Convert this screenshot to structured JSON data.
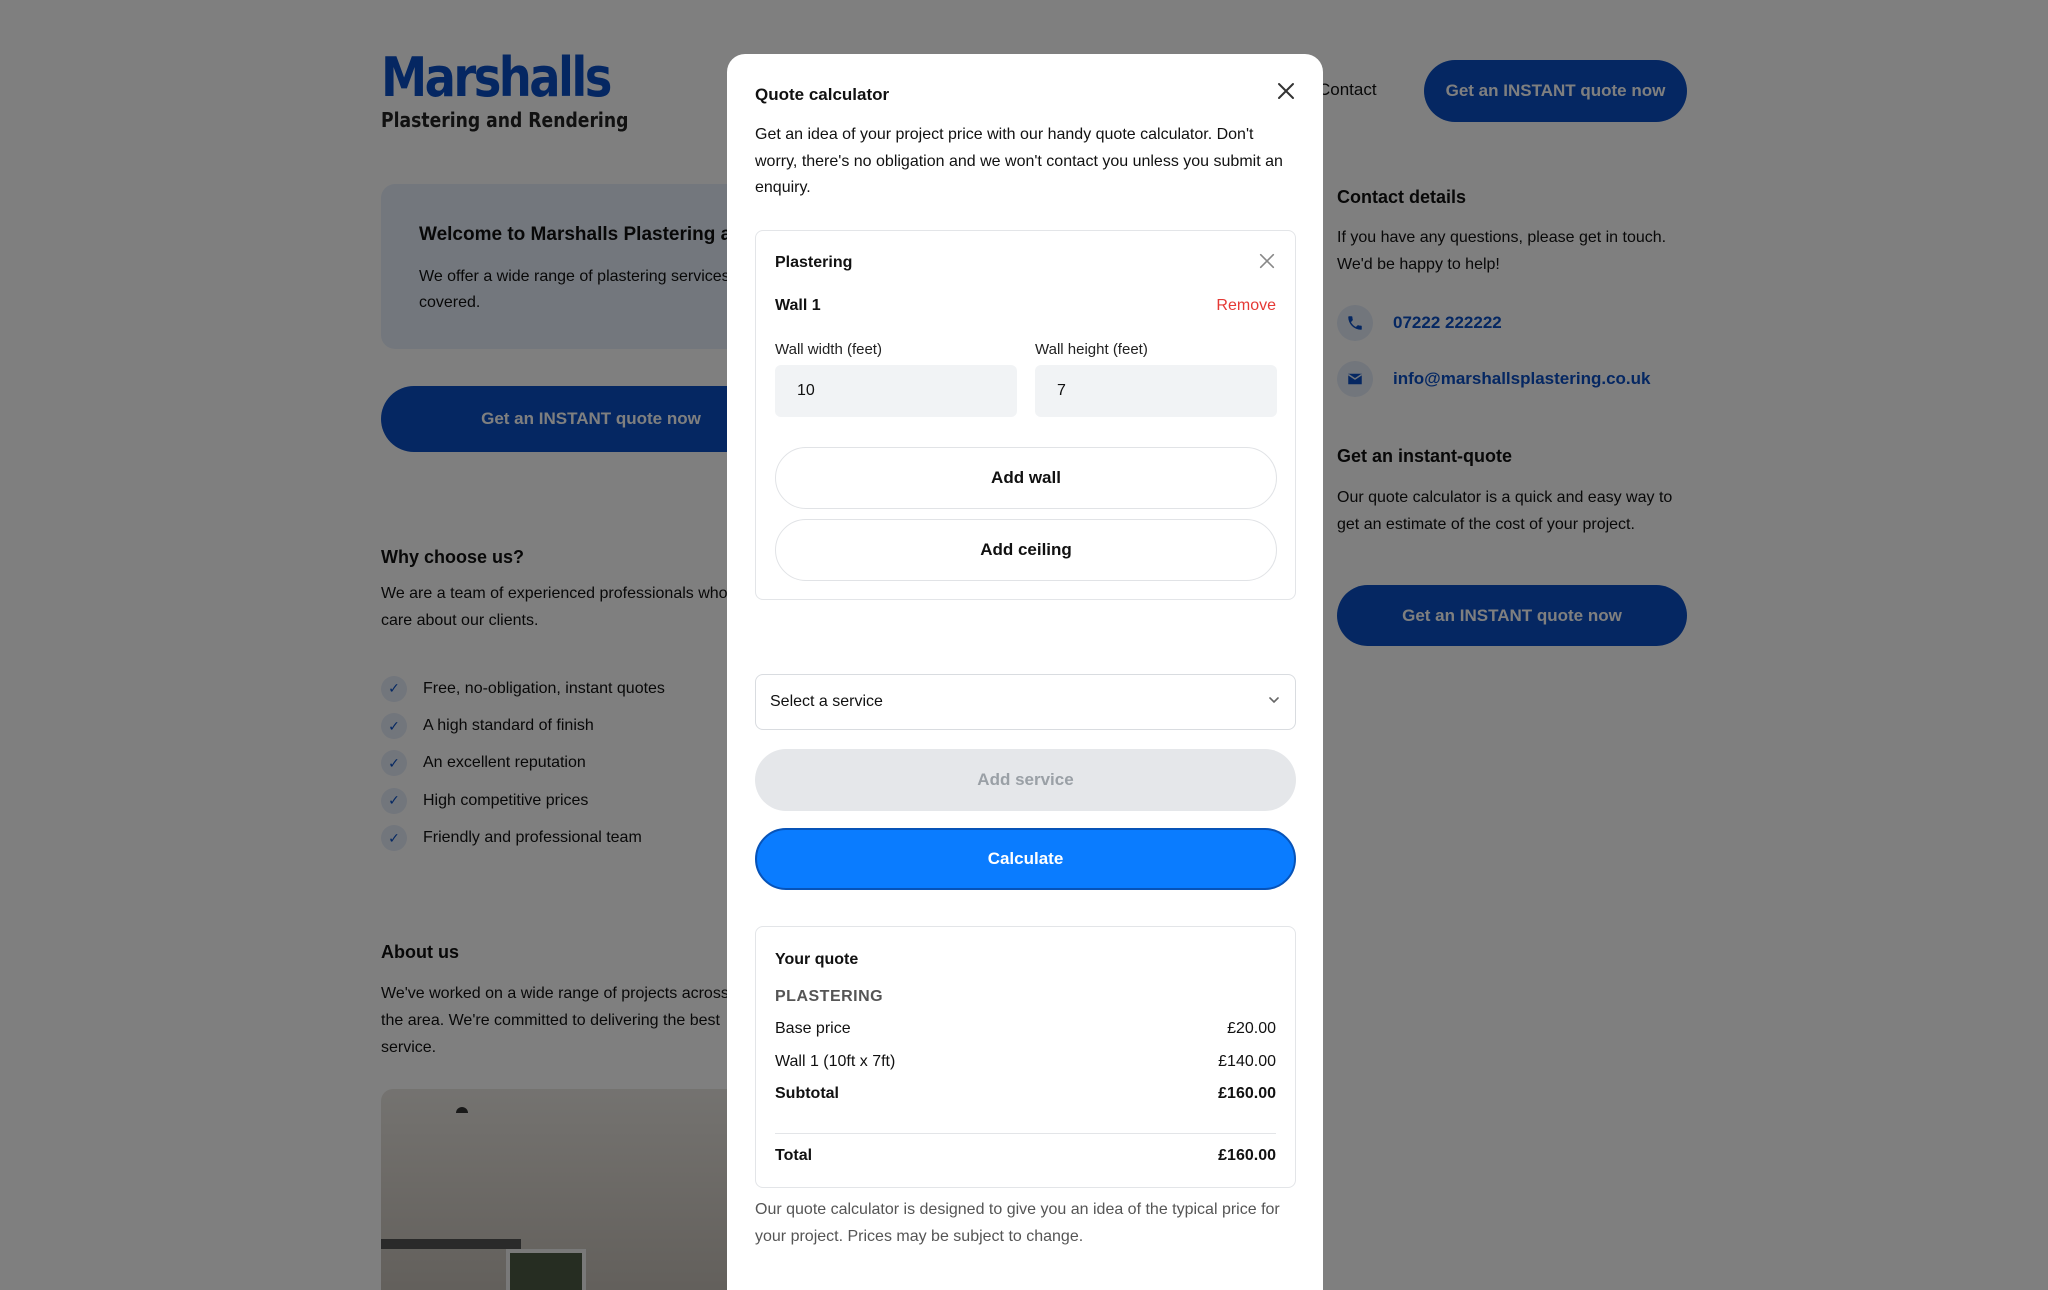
{
  "brand": {
    "name": "Marshalls",
    "tagline": "Plastering and Rendering",
    "accent": "#0a4fc4"
  },
  "header": {
    "nav_contact": "Contact",
    "cta": "Get an INSTANT quote now"
  },
  "hero": {
    "title": "Welcome to Marshalls Plastering and Rendering",
    "text": "We offer a wide range of plastering services to get you covered.",
    "cta": "Get an INSTANT quote now"
  },
  "why": {
    "title": "Why choose us?",
    "text": "We are a team of experienced professionals who care about our clients.",
    "items": [
      "Free, no-obligation, instant quotes",
      "A high standard of finish",
      "An excellent reputation",
      "High competitive prices",
      "Friendly and professional team"
    ]
  },
  "about": {
    "title": "About us",
    "text": "We've worked on a wide range of projects across the area. We're committed to delivering the best service."
  },
  "sidebar": {
    "contact_title": "Contact details",
    "contact_text": "If you have any questions, please get in touch. We'd be happy to help!",
    "phone": "07222 222222",
    "email": "info@marshallsplastering.co.uk",
    "quote_title": "Get an instant-quote",
    "quote_text": "Our quote calculator is a quick and easy way to get an estimate of the cost of your project.",
    "cta": "Get an INSTANT quote now"
  },
  "modal": {
    "title": "Quote calculator",
    "intro": "Get an idea of your project price with our handy quote calculator. Don't worry, there's no obligation and we won't contact you unless you submit an enquiry.",
    "service": {
      "title": "Plastering",
      "wall_name": "Wall 1",
      "remove": "Remove",
      "width_label": "Wall width (feet)",
      "width_value": "10",
      "height_label": "Wall height (feet)",
      "height_value": "7",
      "add_wall": "Add wall",
      "add_ceiling": "Add ceiling"
    },
    "select_placeholder": "Select a service",
    "add_service": "Add service",
    "calculate": "Calculate",
    "quote": {
      "title": "Your quote",
      "section": "PLASTERING",
      "rows": [
        {
          "label": "Base price",
          "value": "£20.00"
        },
        {
          "label": "Wall 1 (10ft x 7ft)",
          "value": "£140.00"
        },
        {
          "label": "Subtotal",
          "value": "£160.00"
        }
      ],
      "total_label": "Total",
      "total_value": "£160.00"
    },
    "disclaimer": "Our quote calculator is designed to give you an idea of the typical price for your project. Prices may be subject to change."
  },
  "colors": {
    "primary": "#0a4fc4",
    "calculate": "#0a7cff",
    "danger": "#e53935"
  }
}
